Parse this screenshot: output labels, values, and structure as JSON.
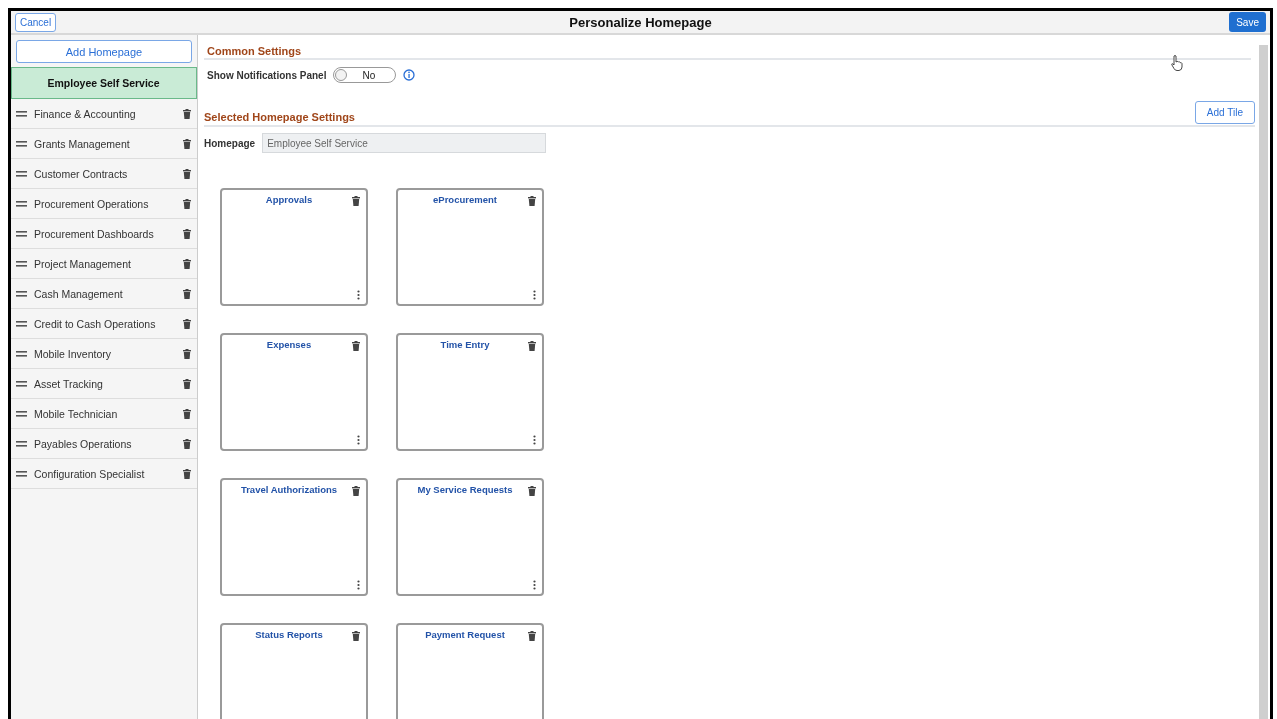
{
  "header": {
    "title": "Personalize Homepage",
    "cancel": "Cancel",
    "save": "Save"
  },
  "sidebar": {
    "add_button": "Add Homepage",
    "items": [
      {
        "label": "Employee Self Service",
        "selected": true
      },
      {
        "label": "Finance & Accounting",
        "selected": false
      },
      {
        "label": "Grants Management",
        "selected": false
      },
      {
        "label": "Customer Contracts",
        "selected": false
      },
      {
        "label": "Procurement Operations",
        "selected": false
      },
      {
        "label": "Procurement Dashboards",
        "selected": false
      },
      {
        "label": "Project Management",
        "selected": false
      },
      {
        "label": "Cash Management",
        "selected": false
      },
      {
        "label": "Credit to Cash Operations",
        "selected": false
      },
      {
        "label": "Mobile Inventory",
        "selected": false
      },
      {
        "label": "Asset Tracking",
        "selected": false
      },
      {
        "label": "Mobile Technician",
        "selected": false
      },
      {
        "label": "Payables Operations",
        "selected": false
      },
      {
        "label": "Configuration Specialist",
        "selected": false
      }
    ]
  },
  "common_settings": {
    "heading": "Common Settings",
    "notifications": {
      "label": "Show Notifications Panel",
      "on": false,
      "state_text": "No"
    }
  },
  "homepage_settings": {
    "heading": "Selected Homepage Settings",
    "add_tile": "Add Tile",
    "homepage_label": "Homepage",
    "homepage_value": "Employee Self Service",
    "tiles": [
      {
        "title": "Approvals"
      },
      {
        "title": "eProcurement"
      },
      {
        "title": "Expenses"
      },
      {
        "title": "Time Entry"
      },
      {
        "title": "Travel Authorizations"
      },
      {
        "title": "My Service Requests"
      },
      {
        "title": "Status Reports"
      },
      {
        "title": "Payment Request"
      }
    ]
  }
}
